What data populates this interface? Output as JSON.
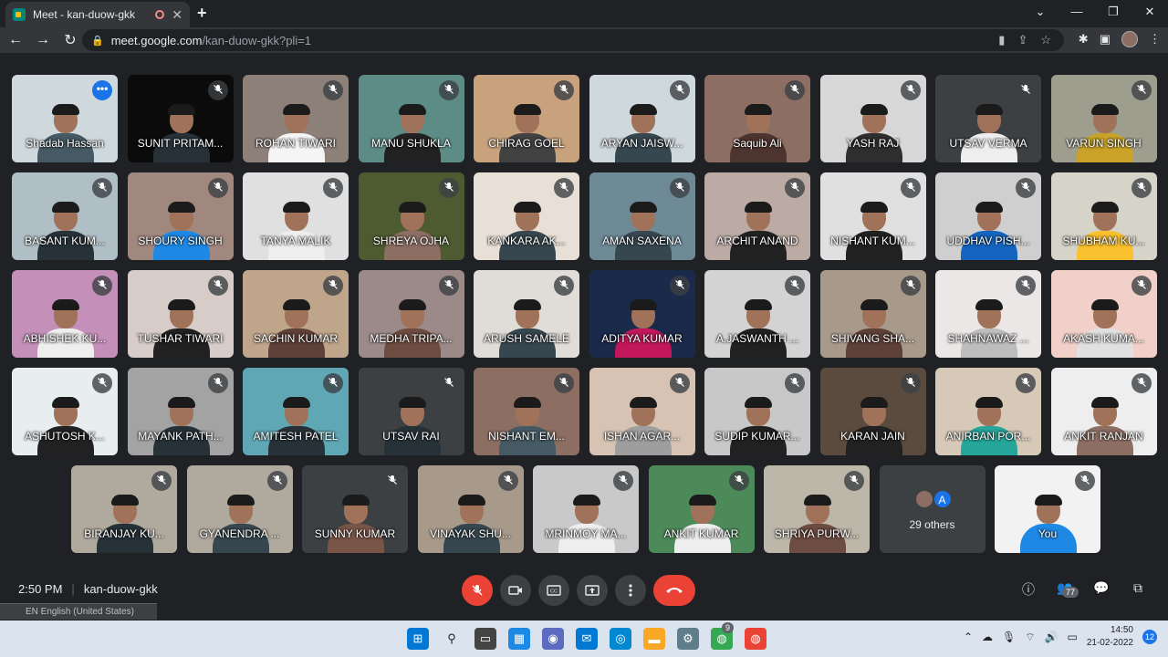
{
  "browser": {
    "tab_title": "Meet - kan-duow-gkk",
    "url_host": "meet.google.com",
    "url_path": "/kan-duow-gkk?pli=1"
  },
  "tiles": [
    {
      "name": "Shadab Hassan",
      "bg": "#cfd8dc",
      "shirt": "#455a64",
      "selected": true
    },
    {
      "name": "SUNIT PRITAM...",
      "bg": "#0b0b0b",
      "shirt": "#263238"
    },
    {
      "name": "ROHAN TIWARI",
      "bg": "#8d8079",
      "shirt": "#f5f5f5"
    },
    {
      "name": "MANU SHUKLA",
      "bg": "#5d8c86",
      "shirt": "#212121"
    },
    {
      "name": "CHIRAG GOEL",
      "bg": "#c7a27c",
      "shirt": "#424242"
    },
    {
      "name": "ARYAN JAISW...",
      "bg": "#cfd8dc",
      "shirt": "#37474f"
    },
    {
      "name": "Saquib Ali",
      "bg": "#8d6e63",
      "shirt": "#4e342e"
    },
    {
      "name": "YASH RAJ",
      "bg": "#d7d7d7",
      "shirt": "#2e2e2e"
    },
    {
      "name": "UTSAV VERMA",
      "bg": "#3c4043",
      "shirt": "#eeeeee"
    },
    {
      "name": "VARUN SINGH",
      "bg": "#9e9e8e",
      "shirt": "#c9a227"
    },
    {
      "name": "BASANT KUM...",
      "bg": "#b0bec5",
      "shirt": "#263238"
    },
    {
      "name": "SHOURY SINGH",
      "bg": "#a1887f",
      "shirt": "#1e88e5"
    },
    {
      "name": "TANYA MALIK",
      "bg": "#e0e0e0",
      "shirt": "#eeeeee"
    },
    {
      "name": "SHREYA OJHA",
      "bg": "#4e5b31",
      "shirt": "#8d6e63"
    },
    {
      "name": "KANKARA AK...",
      "bg": "#e8e0d6",
      "shirt": "#37474f"
    },
    {
      "name": "AMAN SAXENA",
      "bg": "#6d8a96",
      "shirt": "#37474f"
    },
    {
      "name": "ARCHIT ANAND",
      "bg": "#bcaaa4",
      "shirt": "#212121"
    },
    {
      "name": "NISHANT KUM...",
      "bg": "#e0e0e0",
      "shirt": "#212121"
    },
    {
      "name": "UDDHAV PISH...",
      "bg": "#d0cfcf",
      "shirt": "#1565c0"
    },
    {
      "name": "SHUBHAM KU...",
      "bg": "#d6d3c8",
      "shirt": "#fbc02d"
    },
    {
      "name": "ABHISHEK KU...",
      "bg": "#c48fb8",
      "shirt": "#eeeeee"
    },
    {
      "name": "TUSHAR TIWARI",
      "bg": "#d7ccc8",
      "shirt": "#212121"
    },
    {
      "name": "SACHIN KUMAR",
      "bg": "#bfa58a",
      "shirt": "#5d4037"
    },
    {
      "name": "MEDHA TRIPA...",
      "bg": "#9b8a88",
      "shirt": "#6d4c41"
    },
    {
      "name": "ARUSH SAMELE",
      "bg": "#e0dcd7",
      "shirt": "#37474f"
    },
    {
      "name": "ADITYA KUMAR",
      "bg": "#1a2a4a",
      "shirt": "#c2185b"
    },
    {
      "name": "A.JASWANTH ...",
      "bg": "#d3d3d3",
      "shirt": "#212121"
    },
    {
      "name": "SHIVANG SHA...",
      "bg": "#a89a8b",
      "shirt": "#5d4037"
    },
    {
      "name": "SHAHNAWAZ ...",
      "bg": "#ece7e7",
      "shirt": "#bdbdbd"
    },
    {
      "name": "AKASH KUMA...",
      "bg": "#f0d0c8",
      "shirt": "#e0e0e0"
    },
    {
      "name": "ASHUTOSH K...",
      "bg": "#e8eef0",
      "shirt": "#212121"
    },
    {
      "name": "MAYANK PATH...",
      "bg": "#a3a3a3",
      "shirt": "#263238"
    },
    {
      "name": "AMITESH PATEL",
      "bg": "#5fa7b5",
      "shirt": "#263238"
    },
    {
      "name": "UTSAV RAI",
      "bg": "#3c4043",
      "shirt": "#263238"
    },
    {
      "name": "NISHANT EM...",
      "bg": "#8d6e63",
      "shirt": "#455a64"
    },
    {
      "name": "ISHAN AGAR...",
      "bg": "#d6c3b3",
      "shirt": "#9e9e9e"
    },
    {
      "name": "SUDIP KUMAR...",
      "bg": "#c8c8c8",
      "shirt": "#212121"
    },
    {
      "name": "KARAN JAIN",
      "bg": "#5b4b3e",
      "shirt": "#212121"
    },
    {
      "name": "ANIRBAN POR...",
      "bg": "#d7c9b8",
      "shirt": "#26a69a"
    },
    {
      "name": "ANKIT RANJAN",
      "bg": "#eeeeee",
      "shirt": "#8d6e63"
    },
    {
      "name": "BIRANJAY KU...",
      "bg": "#b0a99e",
      "shirt": "#263238"
    },
    {
      "name": "GYANENDRA ...",
      "bg": "#b0a99e",
      "shirt": "#37474f"
    },
    {
      "name": "SUNNY KUMAR",
      "bg": "#3c4043",
      "shirt": "#795548"
    },
    {
      "name": "VINAYAK SHU...",
      "bg": "#a89a8b",
      "shirt": "#37474f"
    },
    {
      "name": "MRINMOY MA...",
      "bg": "#c9c9c9",
      "shirt": "#eeeeee"
    },
    {
      "name": "ANKIT KUMAR",
      "bg": "#4c8a5a",
      "shirt": "#eeeeee"
    },
    {
      "name": "SHRIYA PURW...",
      "bg": "#bdb7a9",
      "shirt": "#6d4c41"
    }
  ],
  "others": {
    "label": "29 others",
    "avatar_letter": "A"
  },
  "self_tile": {
    "name": "You",
    "bg": "#f2f2f2",
    "shirt": "#1e88e5"
  },
  "meeting": {
    "time": "2:50 PM",
    "code": "kan-duow-gkk",
    "participants_count": "77"
  },
  "lang_bar": "EN English (United States)",
  "taskbar": {
    "time": "14:50",
    "date": "21-02-2022",
    "notifications": "12",
    "chrome_badge": "9"
  }
}
